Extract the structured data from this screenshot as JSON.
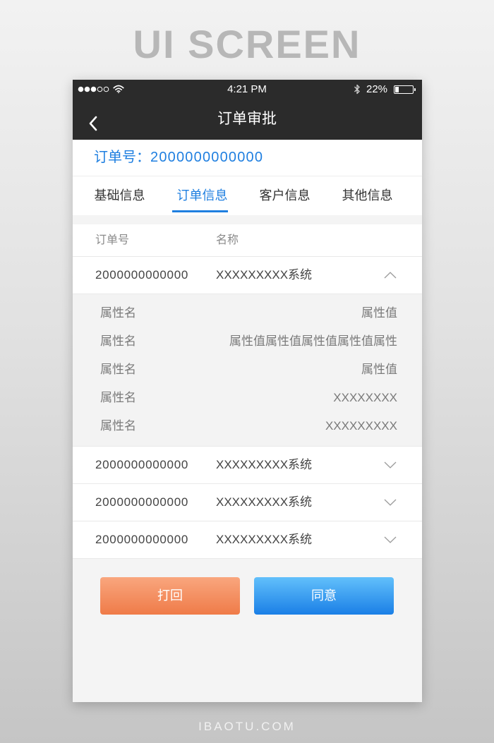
{
  "backdrop": {
    "heading": "UI SCREEN",
    "footer": "IBAOTU.COM"
  },
  "status_bar": {
    "time": "4:21 PM",
    "battery_text": "22%",
    "battery_level": 0.22,
    "signal_filled": 3,
    "signal_total": 5,
    "icons": [
      "signal-dots-icon",
      "wifi-icon",
      "bluetooth-icon",
      "battery-icon"
    ]
  },
  "nav": {
    "title": "订单审批",
    "back_icon": "chevron-left-icon"
  },
  "order": {
    "label": "订单号：",
    "number": "2000000000000"
  },
  "tabs": {
    "active_index": 1,
    "items": [
      {
        "label": "基础信息"
      },
      {
        "label": "订单信息"
      },
      {
        "label": "客户信息"
      },
      {
        "label": "其他信息"
      }
    ]
  },
  "table": {
    "headers": {
      "order_no": "订单号",
      "name": "名称"
    },
    "rows": [
      {
        "order_no": "2000000000000",
        "name": "XXXXXXXXX系统",
        "expanded": true,
        "toggle_icon": "chevron-up-icon",
        "details": [
          {
            "key": "属性名",
            "value": "属性值"
          },
          {
            "key": "属性名",
            "value": "属性值属性值属性值属性值属性"
          },
          {
            "key": "属性名",
            "value": "属性值"
          },
          {
            "key": "属性名",
            "value": "XXXXXXXX"
          },
          {
            "key": "属性名",
            "value": "XXXXXXXXX"
          }
        ]
      },
      {
        "order_no": "2000000000000",
        "name": "XXXXXXXXX系统",
        "expanded": false,
        "toggle_icon": "chevron-down-icon"
      },
      {
        "order_no": "2000000000000",
        "name": "XXXXXXXXX系统",
        "expanded": false,
        "toggle_icon": "chevron-down-icon"
      },
      {
        "order_no": "2000000000000",
        "name": "XXXXXXXXX系统",
        "expanded": false,
        "toggle_icon": "chevron-down-icon"
      }
    ]
  },
  "actions": {
    "reject_label": "打回",
    "approve_label": "同意"
  },
  "colors": {
    "bar_background": "#2b2b2b",
    "accent_blue": "#1f7fe0",
    "text_primary": "#333333",
    "text_secondary": "#8a8a8a",
    "reject_top": "#f9a67e",
    "reject_bottom": "#ef7b48",
    "approve_top": "#62c0fb",
    "approve_bottom": "#1a7fe6"
  }
}
